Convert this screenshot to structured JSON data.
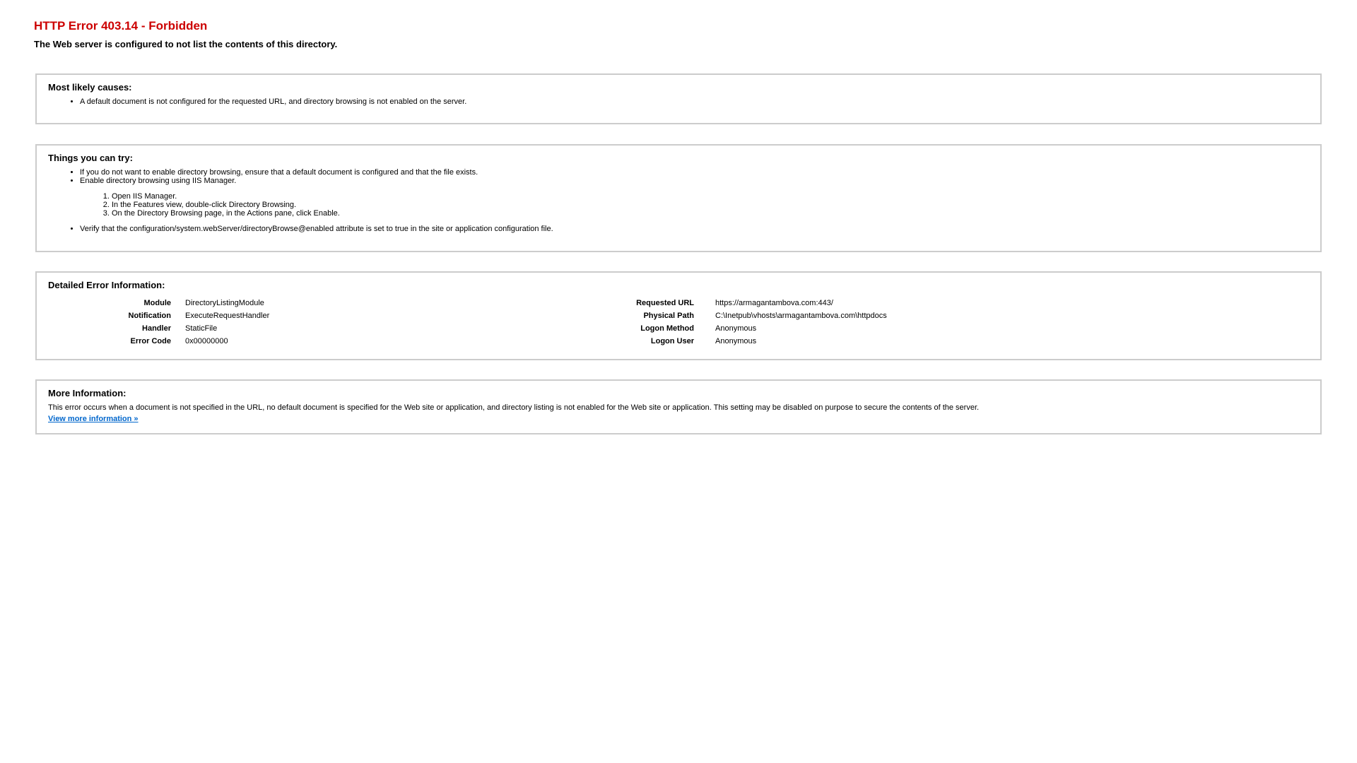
{
  "header": {
    "title": "HTTP Error 403.14 - Forbidden",
    "subtitle": "The Web server is configured to not list the contents of this directory."
  },
  "causes": {
    "heading": "Most likely causes:",
    "items": [
      "A default document is not configured for the requested URL, and directory browsing is not enabled on the server."
    ]
  },
  "try": {
    "heading": "Things you can try:",
    "bullet1": "If you do not want to enable directory browsing, ensure that a default document is configured and that the file exists.",
    "bullet2": "Enable directory browsing using IIS Manager.",
    "steps": [
      "Open IIS Manager.",
      "In the Features view, double-click Directory Browsing.",
      "On the Directory Browsing page, in the Actions pane, click Enable."
    ],
    "bullet3": "Verify that the configuration/system.webServer/directoryBrowse@enabled attribute is set to true in the site or application configuration file."
  },
  "details": {
    "heading": "Detailed Error Information:",
    "left": [
      {
        "label": "Module",
        "value": "DirectoryListingModule"
      },
      {
        "label": "Notification",
        "value": "ExecuteRequestHandler"
      },
      {
        "label": "Handler",
        "value": "StaticFile"
      },
      {
        "label": "Error Code",
        "value": "0x00000000"
      }
    ],
    "right": [
      {
        "label": "Requested URL",
        "value": "https://armagantambova.com:443/"
      },
      {
        "label": "Physical Path",
        "value": "C:\\Inetpub\\vhosts\\armagantambova.com\\httpdocs"
      },
      {
        "label": "Logon Method",
        "value": "Anonymous"
      },
      {
        "label": "Logon User",
        "value": "Anonymous"
      }
    ]
  },
  "more": {
    "heading": "More Information:",
    "text": "This error occurs when a document is not specified in the URL, no default document is specified for the Web site or application, and directory listing is not enabled for the Web site or application. This setting may be disabled on purpose to secure the contents of the server.",
    "link_label": "View more information »"
  },
  "colors": {
    "title": "#cc0000",
    "link": "#0066cc",
    "border": "#cccccc"
  }
}
